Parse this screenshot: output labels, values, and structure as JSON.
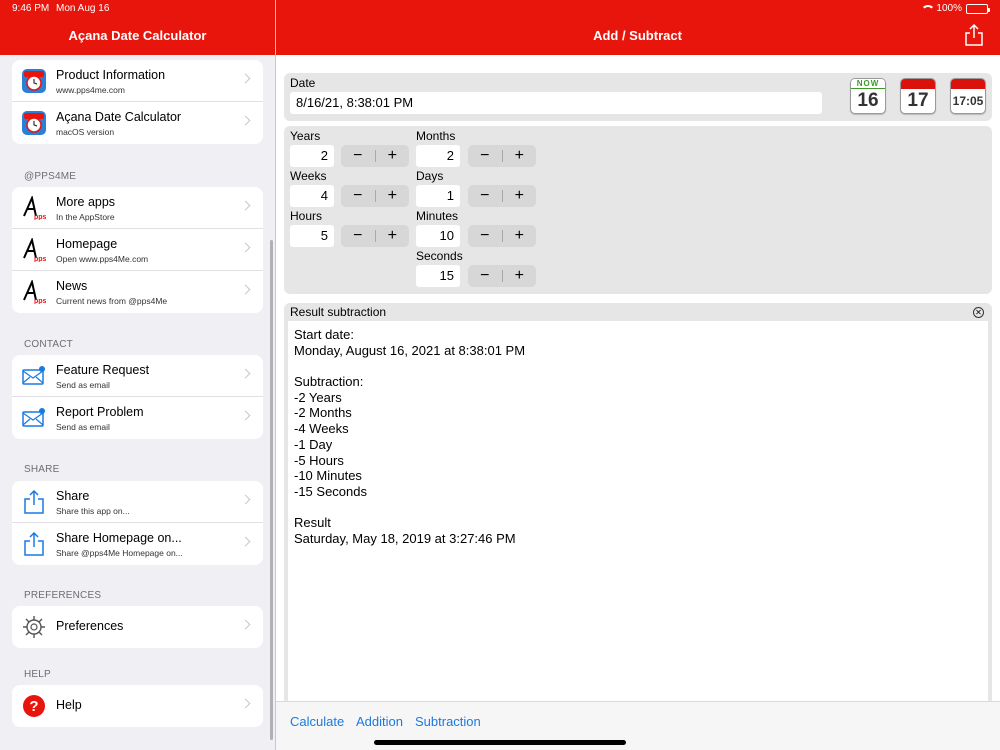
{
  "status": {
    "time": "9:46 PM",
    "date": "Mon Aug 16",
    "battery": "100%"
  },
  "sidebar": {
    "title": "Açana Date Calculator",
    "groups": [
      {
        "header": "",
        "items": [
          {
            "title": "Product Information",
            "subtitle": "www.pps4me.com",
            "icon": "alarm-clock-app-icon"
          },
          {
            "title": "Açana Date Calculator",
            "subtitle": "macOS version",
            "icon": "alarm-clock-app-icon"
          }
        ]
      },
      {
        "header": "@PPS4ME",
        "items": [
          {
            "title": "More apps",
            "subtitle": "In the AppStore",
            "icon": "pps-logo-icon"
          },
          {
            "title": "Homepage",
            "subtitle": "Open www.pps4Me.com",
            "icon": "pps-logo-icon"
          },
          {
            "title": "News",
            "subtitle": "Current news from @pps4Me",
            "icon": "pps-logo-icon"
          }
        ]
      },
      {
        "header": "CONTACT",
        "items": [
          {
            "title": "Feature Request",
            "subtitle": "Send as email",
            "icon": "mail-icon"
          },
          {
            "title": "Report Problem",
            "subtitle": "Send as email",
            "icon": "mail-icon"
          }
        ]
      },
      {
        "header": "SHARE",
        "items": [
          {
            "title": "Share",
            "subtitle": "Share this app on...",
            "icon": "share-icon"
          },
          {
            "title": "Share Homepage on...",
            "subtitle": "Share @pps4Me Homepage on...",
            "icon": "share-icon"
          }
        ]
      },
      {
        "header": "PREFERENCES",
        "items": [
          {
            "title": "Preferences",
            "subtitle": "",
            "icon": "gear-icon"
          }
        ]
      },
      {
        "header": "HELP",
        "items": [
          {
            "title": "Help",
            "subtitle": "",
            "icon": "help-icon"
          }
        ]
      }
    ]
  },
  "main": {
    "title": "Add / Subtract",
    "date_label": "Date",
    "date_value": "8/16/21, 8:38:01 PM",
    "cal_icons": {
      "now_label": "NOW",
      "now_day": "16",
      "cal_day": "17",
      "time": "17:05"
    },
    "fields": {
      "years": {
        "label": "Years",
        "value": "2"
      },
      "months": {
        "label": "Months",
        "value": "2"
      },
      "weeks": {
        "label": "Weeks",
        "value": "4"
      },
      "days": {
        "label": "Days",
        "value": "1"
      },
      "hours": {
        "label": "Hours",
        "value": "5"
      },
      "minutes": {
        "label": "Minutes",
        "value": "10"
      },
      "seconds": {
        "label": "Seconds",
        "value": "15"
      }
    },
    "stepper": {
      "minus": "−",
      "plus": "+"
    },
    "result_title": "Result subtraction",
    "result_lines": [
      "Start date:",
      "Monday, August 16, 2021 at 8:38:01 PM",
      "",
      "Subtraction:",
      "-2 Years",
      "-2 Months",
      "-4 Weeks",
      "-1 Day",
      "-5 Hours",
      "-10 Minutes",
      "-15 Seconds",
      "",
      "Result",
      "Saturday, May 18, 2019 at 3:27:46 PM"
    ]
  },
  "toolbar": {
    "calculate": "Calculate",
    "addition": "Addition",
    "subtraction": "Subtraction"
  },
  "colors": {
    "accent": "#e8150c",
    "link": "#1a7ae0"
  }
}
